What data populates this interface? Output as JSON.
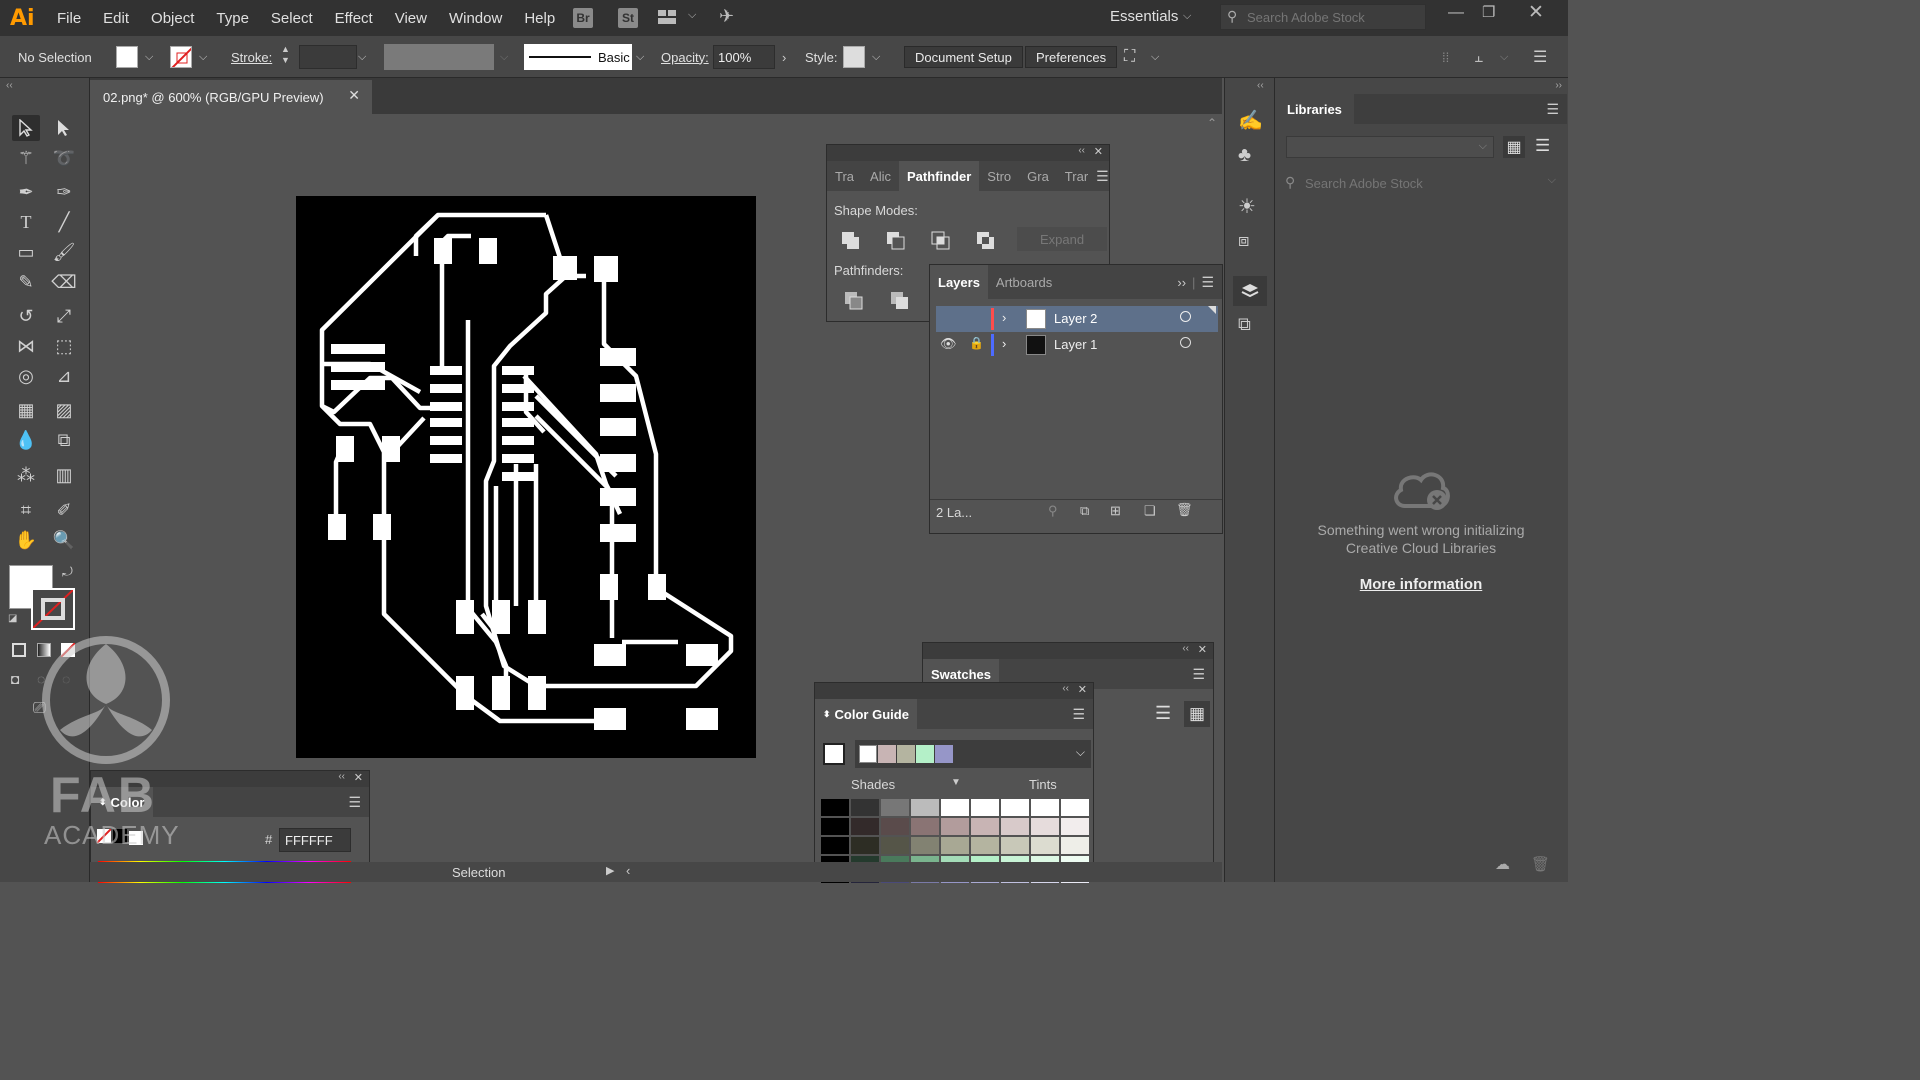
{
  "app": {
    "logo": "Ai"
  },
  "menu": [
    "File",
    "Edit",
    "Object",
    "Type",
    "Select",
    "Effect",
    "View",
    "Window",
    "Help"
  ],
  "menu_icons": {
    "bridge": "Br",
    "stock": "St"
  },
  "workspace": "Essentials",
  "search_stock_placeholder": "Search Adobe Stock",
  "control": {
    "selection_label": "No Selection",
    "stroke_label": "Stroke:",
    "brush_label": "Basic",
    "opacity_label": "Opacity:",
    "opacity_value": "100%",
    "style_label": "Style:",
    "document_setup": "Document Setup",
    "preferences": "Preferences"
  },
  "document": {
    "tab_title": "02.png* @ 600% (RGB/GPU Preview)"
  },
  "pathfinder": {
    "tabs": [
      "Tra",
      "Alic",
      "Pathfinder",
      "Stro",
      "Gra",
      "Trar"
    ],
    "shape_modes_label": "Shape Modes:",
    "expand_label": "Expand",
    "pathfinders_label": "Pathfinders:"
  },
  "layers": {
    "tabs": [
      "Layers",
      "Artboards"
    ],
    "rows": [
      {
        "name": "Layer 2",
        "color": "#ff4d4d",
        "selected": true
      },
      {
        "name": "Layer 1",
        "color": "#4d6bff",
        "selected": false
      }
    ],
    "count_label": "2 La..."
  },
  "swatches": {
    "title": "Swatches"
  },
  "color_guide": {
    "title": "Color Guide",
    "shades_label": "Shades",
    "tints_label": "Tints",
    "harmony_colors": [
      "#ffffff",
      "#c8b4b4",
      "#b4b4a0",
      "#b4f0c8",
      "#9696c8"
    ]
  },
  "color_panel": {
    "title": "Color",
    "hex_label": "#",
    "hex_value": "FFFFFF"
  },
  "libraries": {
    "title": "Libraries",
    "search_placeholder": "Search Adobe Stock",
    "error_line1": "Something went wrong initializing",
    "error_line2": "Creative Cloud Libraries",
    "more_info": "More information"
  },
  "status": {
    "tool": "Selection"
  },
  "watermark": {
    "line1": "FAB",
    "line2": "ACADEMY"
  },
  "icons": {
    "selection": "selection-tool-icon",
    "direct_selection": "direct-selection-tool-icon",
    "close": "close-icon"
  }
}
